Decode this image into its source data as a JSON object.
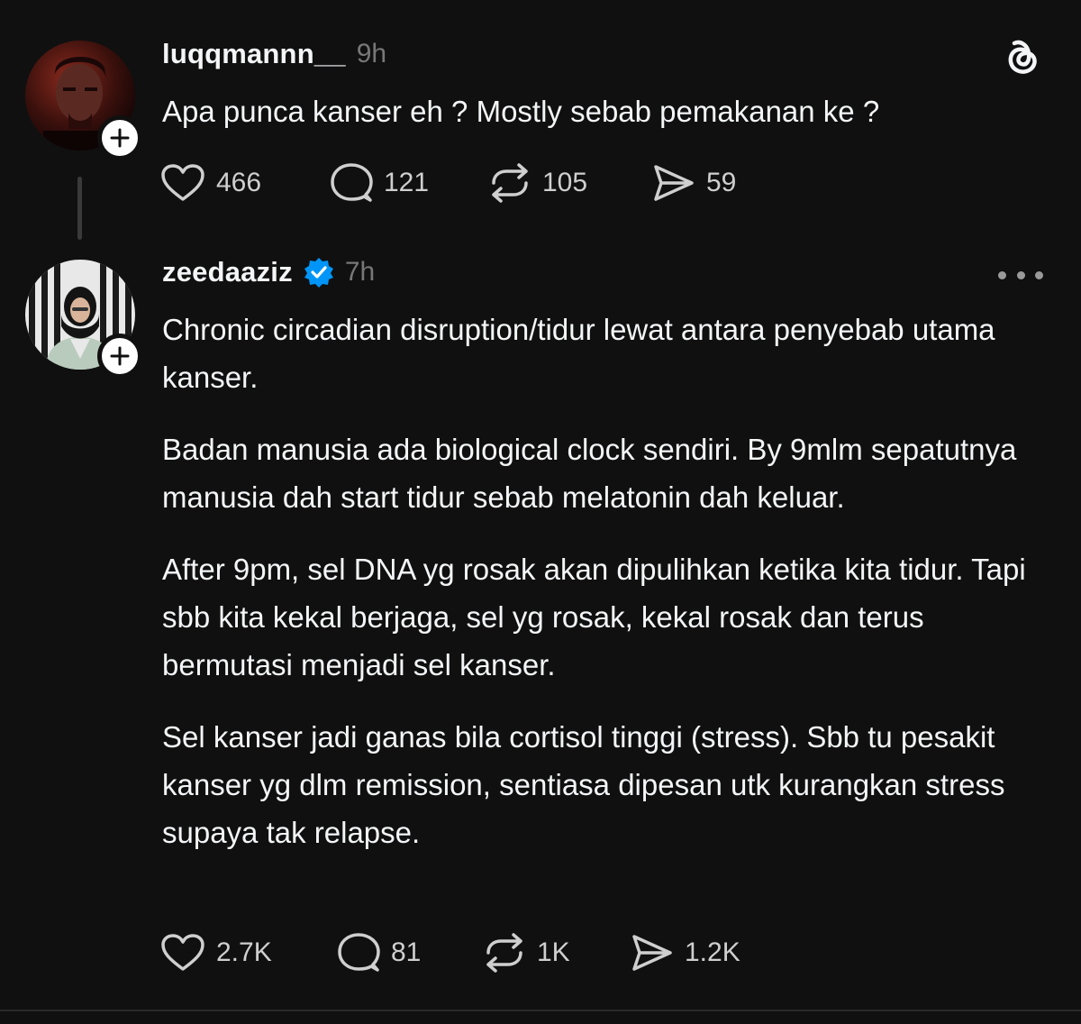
{
  "header": {
    "logo_icon": "threads-logo-icon"
  },
  "posts": [
    {
      "username": "luqqmannn__",
      "time": "9h",
      "verified": false,
      "avatar_icon": "avatar-luqqmannn",
      "paragraphs": [
        "Apa punca kanser eh ? Mostly sebab pemakanan ke ?"
      ],
      "actions": {
        "likes": "466",
        "replies": "121",
        "reposts": "105",
        "shares": "59"
      }
    },
    {
      "username": "zeedaaziz",
      "time": "7h",
      "verified": true,
      "avatar_icon": "avatar-zeedaaziz",
      "paragraphs": [
        "Chronic circadian disruption/tidur lewat antara penyebab utama kanser.",
        "Badan manusia ada biological clock sendiri. By 9mlm sepatutnya manusia dah start tidur sebab melatonin dah keluar.",
        "After 9pm, sel DNA yg rosak akan dipulihkan ketika kita tidur. Tapi sbb kita kekal berjaga, sel yg rosak, kekal rosak dan terus bermutasi menjadi sel kanser.",
        "Sel kanser jadi ganas bila cortisol tinggi (stress). Sbb tu pesakit kanser yg dlm remission, sentiasa dipesan utk kurangkan stress supaya tak relapse."
      ],
      "actions": {
        "likes": "2.7K",
        "replies": "81",
        "reposts": "1K",
        "shares": "1.2K"
      }
    }
  ],
  "colors": {
    "background": "#101010",
    "text_primary": "#f3f5f7",
    "text_muted": "#777777",
    "verified_blue": "#0095f6"
  }
}
